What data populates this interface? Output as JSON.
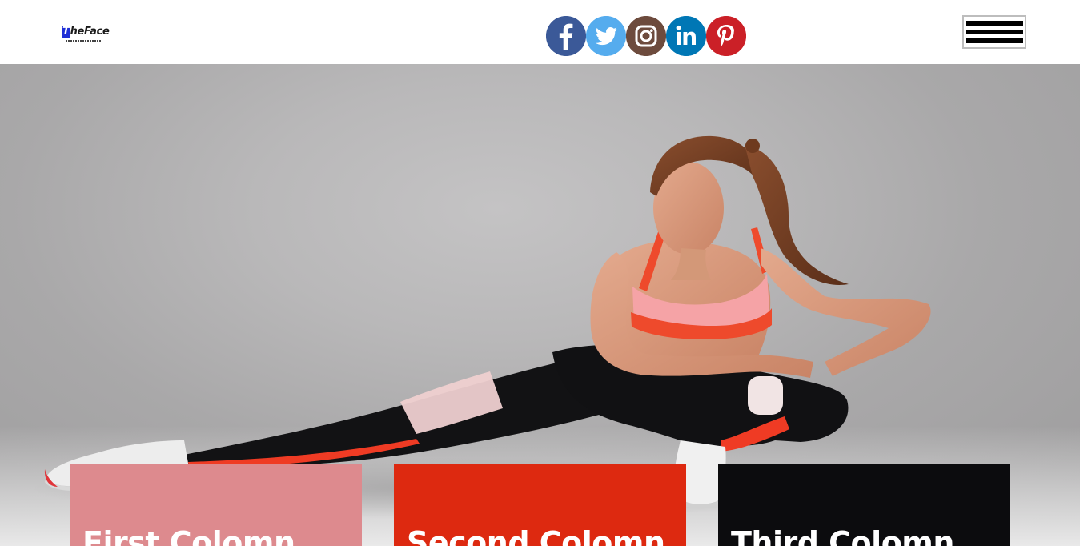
{
  "header": {
    "logo": {
      "text_first": "T",
      "text_rest": "heFace"
    },
    "social_links": [
      {
        "name": "facebook",
        "icon": "facebook-icon",
        "color": "#3b5998"
      },
      {
        "name": "twitter",
        "icon": "twitter-icon",
        "color": "#55acee"
      },
      {
        "name": "instagram",
        "icon": "instagram-icon",
        "color": "#6d4b3d"
      },
      {
        "name": "linkedin",
        "icon": "linkedin-icon",
        "color": "#0077b5"
      },
      {
        "name": "pinterest",
        "icon": "pinterest-icon",
        "color": "#cb2027"
      }
    ],
    "menu_icon": "hamburger-icon"
  },
  "hero": {
    "image": "woman-stretching-photo"
  },
  "columns": [
    {
      "title": "First Colomn",
      "color": "#dd8a8e"
    },
    {
      "title": "Second Colomn",
      "color": "#dd2910"
    },
    {
      "title": "Third Colomn",
      "color": "#0c0c0e"
    }
  ]
}
